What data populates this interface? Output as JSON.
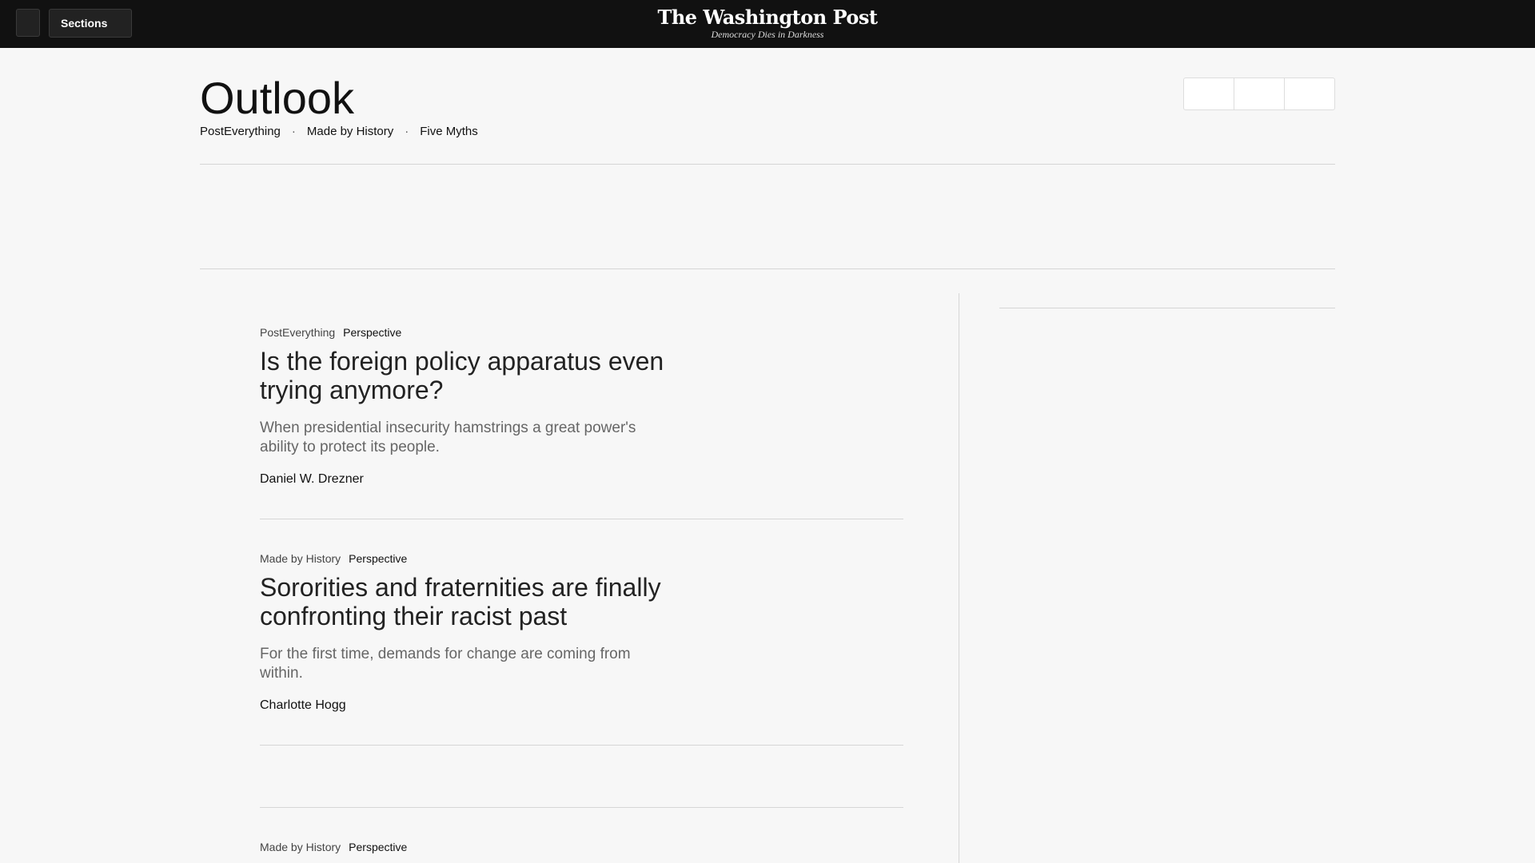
{
  "header": {
    "sections_label": "Sections",
    "logo_name": "The Washington Post",
    "logo_tagline": "Democracy Dies in Darkness"
  },
  "page": {
    "title": "Outlook",
    "subnav": [
      "PostEverything",
      "Made by History",
      "Five Myths"
    ],
    "separator": "·"
  },
  "stories": [
    {
      "section": "PostEverything",
      "label": "Perspective",
      "headline": "Is the foreign policy apparatus even trying anymore?",
      "blurb": "When presidential insecurity hamstrings a great power's ability to protect its people.",
      "byline": "Daniel W. Drezner"
    },
    {
      "section": "Made by History",
      "label": "Perspective",
      "headline": "Sororities and fraternities are finally confronting their racist past",
      "blurb": "For the first time, demands for change are coming from within.",
      "byline": "Charlotte Hogg"
    },
    {
      "section": "Made by History",
      "label": "Perspective"
    }
  ],
  "colors": {
    "topbar": "#111111",
    "background": "#f7f7f7",
    "rule": "#d6d6d6"
  }
}
